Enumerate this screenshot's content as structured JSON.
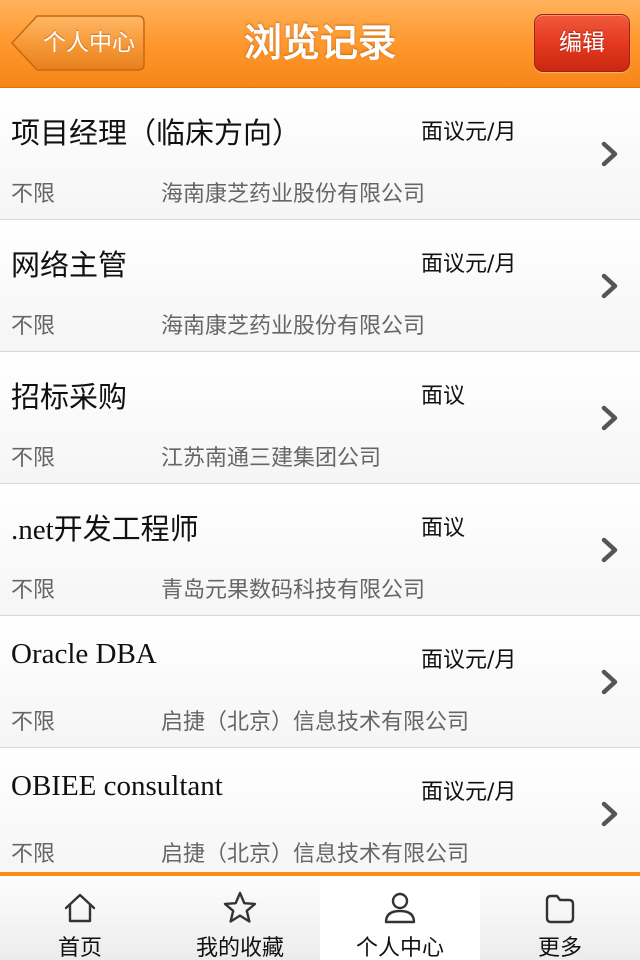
{
  "header": {
    "back_label": "个人中心",
    "title": "浏览记录",
    "edit_label": "编辑"
  },
  "records": [
    {
      "title": "项目经理（临床方向）",
      "salary": "面议元/月",
      "experience": "不限",
      "company": "海南康芝药业股份有限公司"
    },
    {
      "title": "网络主管",
      "salary": "面议元/月",
      "experience": "不限",
      "company": "海南康芝药业股份有限公司"
    },
    {
      "title": "招标采购",
      "salary": "面议",
      "experience": "不限",
      "company": "江苏南通三建集团公司"
    },
    {
      "title": ".net开发工程师",
      "salary": "面议",
      "experience": "不限",
      "company": "青岛元果数码科技有限公司"
    },
    {
      "title": "Oracle DBA",
      "salary": "面议元/月",
      "experience": "不限",
      "company": "启捷（北京）信息技术有限公司"
    },
    {
      "title": "OBIEE consultant",
      "salary": "面议元/月",
      "experience": "不限",
      "company": "启捷（北京）信息技术有限公司"
    }
  ],
  "tabbar": {
    "tabs": [
      {
        "label": "首页",
        "icon": "home-icon"
      },
      {
        "label": "我的收藏",
        "icon": "star-icon"
      },
      {
        "label": "个人中心",
        "icon": "user-icon"
      },
      {
        "label": "更多",
        "icon": "folder-icon"
      }
    ],
    "active": "个人中心"
  },
  "colors": {
    "header_orange": "#ff9a32",
    "edit_red": "#e33a20",
    "tab_accent": "#ff8c1a"
  }
}
